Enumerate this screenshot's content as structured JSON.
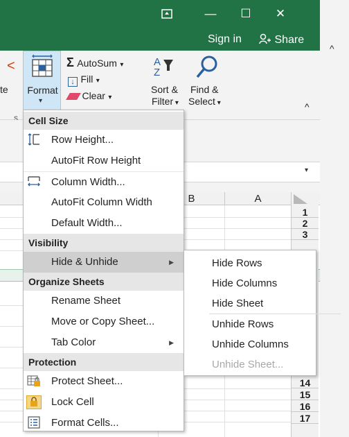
{
  "window": {
    "restore_icon": "ribbon-display-icon",
    "minimize": "—",
    "maximize": "☐",
    "close": "✕",
    "sign_in": "Sign in",
    "share": "Share"
  },
  "ribbon": {
    "partial_left_label": "te",
    "format_label": "Format",
    "format_caret": "▾",
    "autosum": "AutoSum",
    "fill": "Fill",
    "clear": "Clear",
    "sort_filter_1": "Sort &",
    "sort_filter_2": "Filter",
    "find_select_1": "Find &",
    "find_select_2": "Select",
    "collapse": "^",
    "group_partial": "s"
  },
  "sheet": {
    "columns": [
      "B",
      "A"
    ],
    "rows": [
      "1",
      "2",
      "3",
      "14",
      "15",
      "16",
      "17"
    ]
  },
  "menu": {
    "sections": {
      "cell_size": "Cell Size",
      "visibility": "Visibility",
      "organize": "Organize Sheets",
      "protection": "Protection"
    },
    "items": {
      "row_height": "Row Height...",
      "autofit_row": "AutoFit Row Height",
      "column_width": "Column Width...",
      "autofit_column": "AutoFit Column Width",
      "default_width": "Default Width...",
      "hide_unhide": "Hide & Unhide",
      "rename_sheet": "Rename Sheet",
      "move_copy": "Move or Copy Sheet...",
      "tab_color": "Tab Color",
      "protect_sheet": "Protect Sheet...",
      "lock_cell": "Lock Cell",
      "format_cells": "Format Cells..."
    }
  },
  "submenu": {
    "hide_rows": "Hide Rows",
    "hide_columns": "Hide Columns",
    "hide_sheet": "Hide Sheet",
    "unhide_rows": "Unhide Rows",
    "unhide_columns": "Unhide Columns",
    "unhide_sheet": "Unhide Sheet..."
  },
  "colors": {
    "title_bar": "#217346",
    "ribbon_bg": "#f3f3f3",
    "highlight": "#cfcfcf",
    "disabled": "#a8a8a8"
  }
}
